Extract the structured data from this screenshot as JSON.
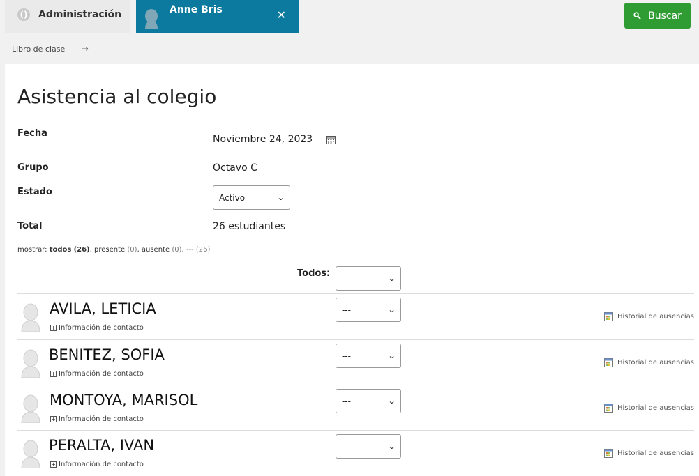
{
  "topbar": {
    "admin_tab": "Administración",
    "user_tab": "Anne Bris",
    "close_glyph": "✕",
    "search_label": "Buscar"
  },
  "breadcrumb": {
    "item": "Libro de clase",
    "arrow": "→"
  },
  "page": {
    "title": "Asistencia al colegio",
    "fields": {
      "fecha_label": "Fecha",
      "fecha_value": "Noviembre 24, 2023",
      "grupo_label": "Grupo",
      "grupo_value": "Octavo C",
      "estado_label": "Estado",
      "estado_value": "Activo",
      "total_label": "Total",
      "total_value": "26 estudiantes"
    },
    "filter": {
      "prefix": "mostrar:",
      "todos": "todos",
      "todos_count": "(26)",
      "presente": "presente",
      "presente_count": "(0)",
      "ausente": "ausente",
      "ausente_count": "(0)",
      "dash": "---",
      "dash_count": "(26)"
    },
    "todos_label": "Todos:",
    "todos_select": "---"
  },
  "students": [
    {
      "name": "AVILA, LETICIA",
      "contact": "Información de contacto",
      "status": "---",
      "history": "Historial de ausencias"
    },
    {
      "name": "BENITEZ, SOFIA",
      "contact": "Información de contacto",
      "status": "---",
      "history": "Historial de ausencias"
    },
    {
      "name": "MONTOYA, MARISOL",
      "contact": "Información de contacto",
      "status": "---",
      "history": "Historial de ausencias"
    },
    {
      "name": "PERALTA, IVAN",
      "contact": "Información de contacto",
      "status": "---",
      "history": "Historial de ausencias"
    }
  ],
  "colors": {
    "active_tab": "#0c7a9e",
    "search_button": "#2e9b33"
  },
  "icons": {
    "logo": "app-logo-icon",
    "avatar": "user-silhouette-icon",
    "search": "search-icon",
    "calendar": "calendar-icon",
    "expand": "plus-box-icon",
    "history": "calendar-history-icon"
  }
}
